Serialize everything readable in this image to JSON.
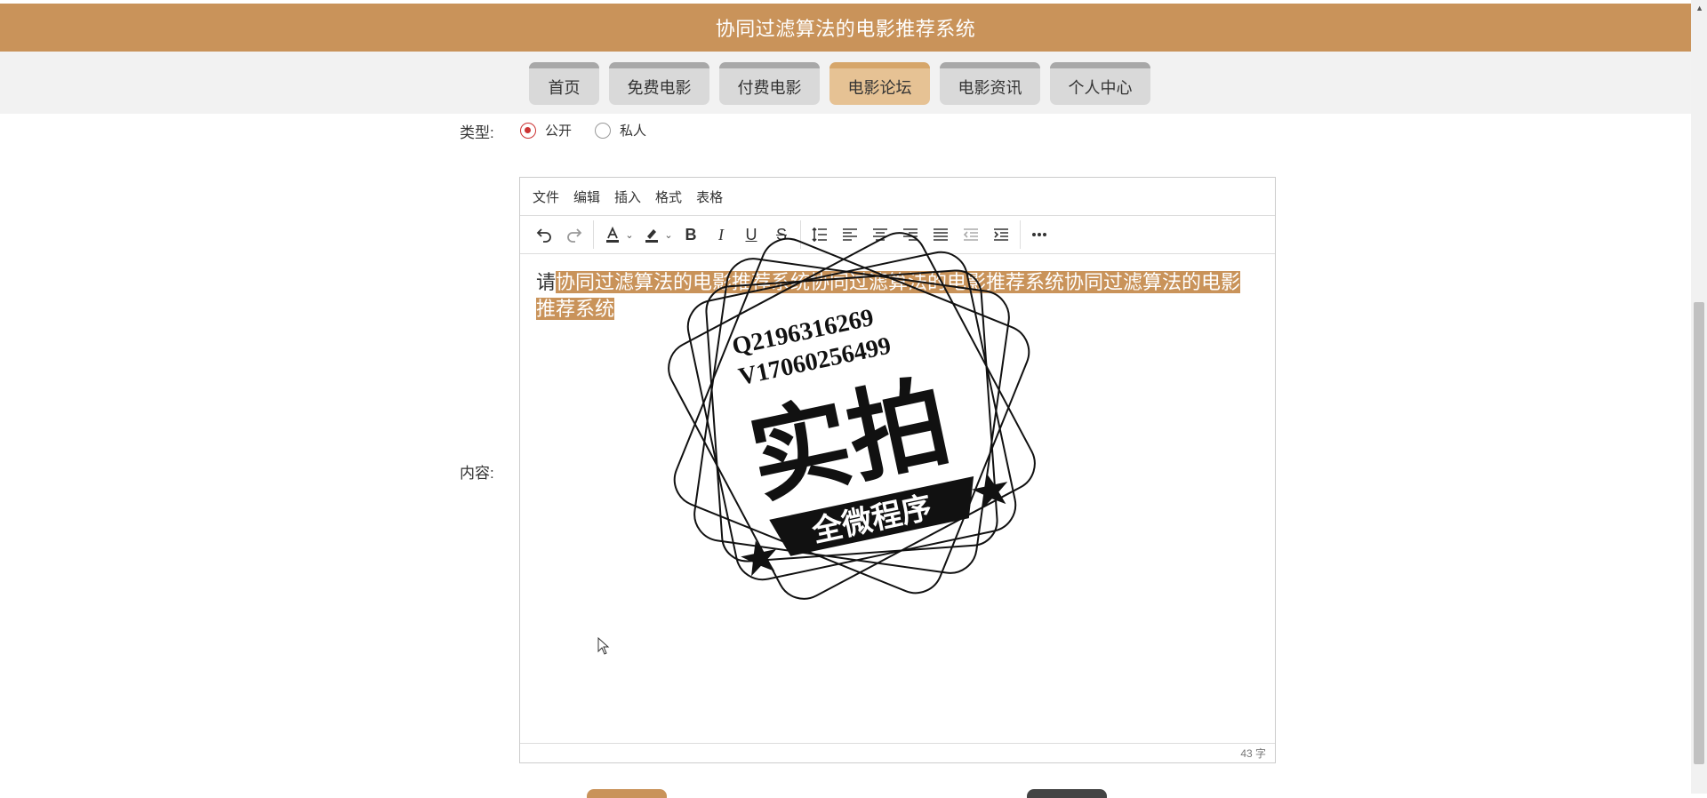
{
  "header": {
    "title": "协同过滤算法的电影推荐系统"
  },
  "nav": {
    "items": [
      {
        "label": "首页",
        "active": false
      },
      {
        "label": "免费电影",
        "active": false
      },
      {
        "label": "付费电影",
        "active": false
      },
      {
        "label": "电影论坛",
        "active": true
      },
      {
        "label": "电影资讯",
        "active": false
      },
      {
        "label": "个人中心",
        "active": false
      }
    ]
  },
  "form": {
    "type_label": "类型:",
    "type_options": [
      {
        "label": "公开",
        "checked": true
      },
      {
        "label": "私人",
        "checked": false
      }
    ],
    "content_label": "内容:"
  },
  "editor": {
    "menus": [
      "文件",
      "编辑",
      "插入",
      "格式",
      "表格"
    ],
    "content_prefix": "请",
    "content_selected": "协同过滤算法的电影推荐系统协同过滤算法的电影推荐系统协同过滤算法的电影推荐系统",
    "word_count": "43 字"
  },
  "watermark": {
    "line1": "Q2196316269",
    "line2": "V17060256499",
    "main": "实拍",
    "banner": "全微程序"
  },
  "colors": {
    "brand": "#c9935a",
    "nav_active": "#e6c294",
    "radio_checked": "#cc3333"
  }
}
